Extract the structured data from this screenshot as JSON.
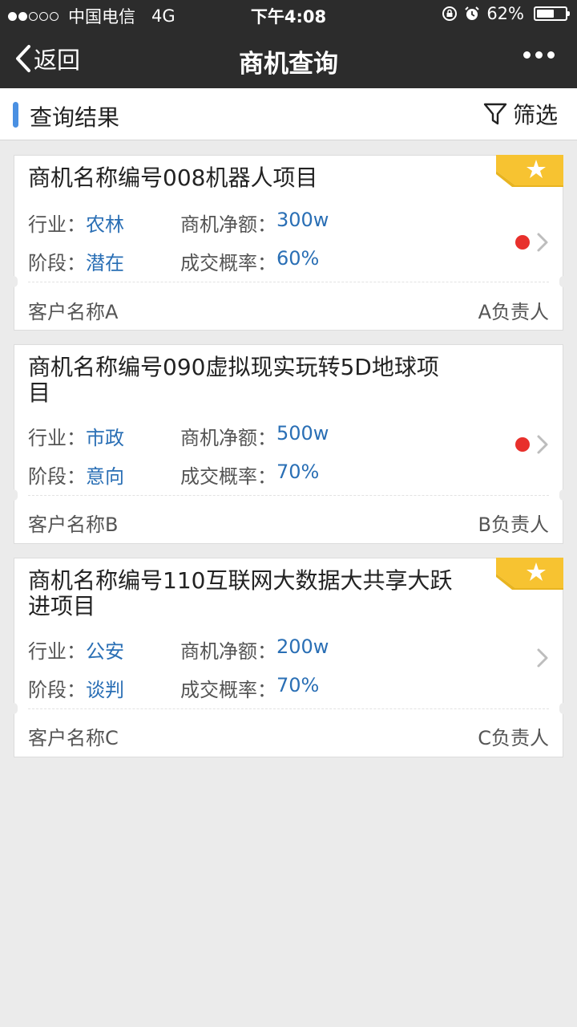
{
  "status_bar": {
    "carrier": "中国电信",
    "network": "4G",
    "time": "下午4:08",
    "battery": "62%",
    "battery_level": 0.62
  },
  "nav": {
    "back_label": "返回",
    "title": "商机查询"
  },
  "section": {
    "title": "查询结果",
    "filter_label": "筛选"
  },
  "labels": {
    "industry": "行业：",
    "amount": "商机净额：",
    "stage": "阶段：",
    "probability": "成交概率："
  },
  "colors": {
    "accent": "#4a90e2",
    "value_text": "#2a6fb5",
    "status_dot": "#e8302c",
    "ribbon": "#f7c331"
  },
  "cards": [
    {
      "title": "商机名称编号008机器人项目",
      "industry": "农林",
      "amount": "300w",
      "stage": "潜在",
      "probability": "60%",
      "customer": "客户名称A",
      "owner": "A负责人",
      "starred": true,
      "alert": true
    },
    {
      "title": "商机名称编号090虚拟现实玩转5D地球项目",
      "industry": "市政",
      "amount": "500w",
      "stage": "意向",
      "probability": "70%",
      "customer": "客户名称B",
      "owner": "B负责人",
      "starred": false,
      "alert": true
    },
    {
      "title": "商机名称编号110互联网大数据大共享大跃进项目",
      "industry": "公安",
      "amount": "200w",
      "stage": "谈判",
      "probability": "70%",
      "customer": "客户名称C",
      "owner": "C负责人",
      "starred": true,
      "alert": false
    }
  ]
}
